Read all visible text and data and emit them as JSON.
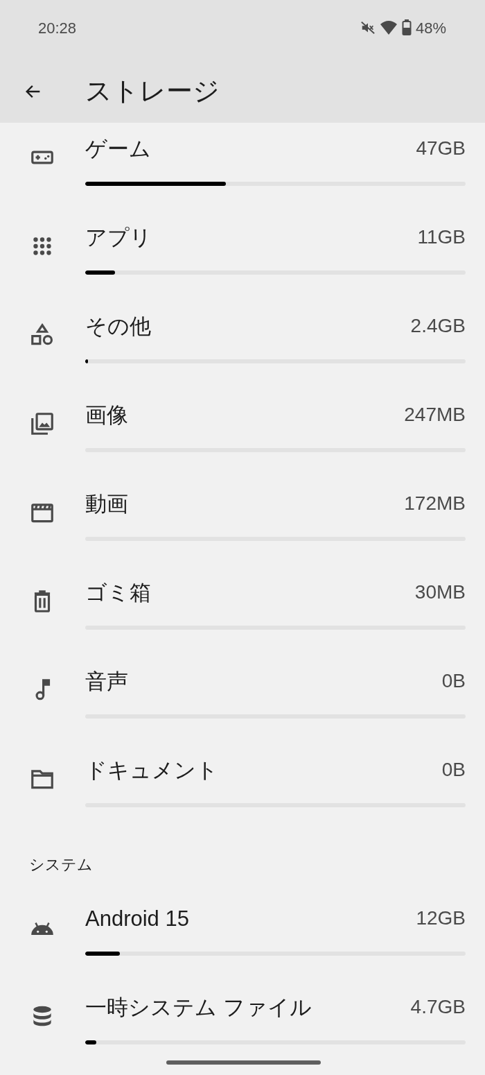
{
  "status_bar": {
    "time": "20:28",
    "battery": "48%"
  },
  "app_bar": {
    "title": "ストレージ"
  },
  "categories": [
    {
      "label": "ゲーム",
      "size": "47GB",
      "level": 0.37
    },
    {
      "label": "アプリ",
      "size": "11GB",
      "level": 0.078
    },
    {
      "label": "その他",
      "size": "2.4GB",
      "level": 0.008
    },
    {
      "label": "画像",
      "size": "247MB"
    },
    {
      "label": "動画",
      "size": "172MB"
    },
    {
      "label": "ゴミ箱",
      "size": "30MB"
    },
    {
      "label": "音声",
      "size": "0B"
    },
    {
      "label": "ドキュメント",
      "size": "0B"
    }
  ],
  "system": {
    "header": "システム",
    "items": [
      {
        "label": "Android 15",
        "size": "12GB",
        "level": 0.091
      },
      {
        "label": "一時システム ファイル",
        "size": "4.7GB",
        "level": 0.03
      }
    ]
  }
}
